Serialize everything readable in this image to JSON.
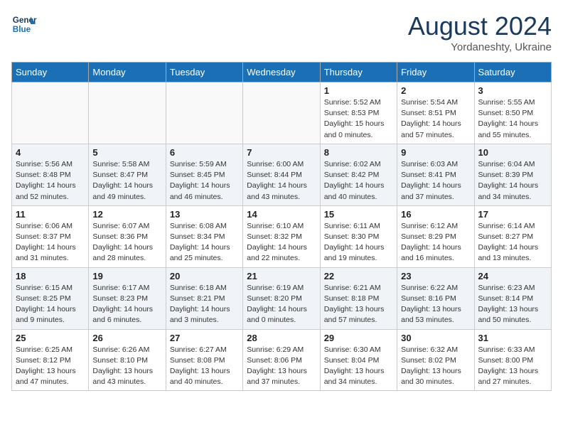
{
  "header": {
    "logo_line1": "General",
    "logo_line2": "Blue",
    "month_year": "August 2024",
    "location": "Yordaneshty, Ukraine"
  },
  "weekdays": [
    "Sunday",
    "Monday",
    "Tuesday",
    "Wednesday",
    "Thursday",
    "Friday",
    "Saturday"
  ],
  "weeks": [
    [
      {
        "day": "",
        "info": ""
      },
      {
        "day": "",
        "info": ""
      },
      {
        "day": "",
        "info": ""
      },
      {
        "day": "",
        "info": ""
      },
      {
        "day": "1",
        "info": "Sunrise: 5:52 AM\nSunset: 8:53 PM\nDaylight: 15 hours\nand 0 minutes."
      },
      {
        "day": "2",
        "info": "Sunrise: 5:54 AM\nSunset: 8:51 PM\nDaylight: 14 hours\nand 57 minutes."
      },
      {
        "day": "3",
        "info": "Sunrise: 5:55 AM\nSunset: 8:50 PM\nDaylight: 14 hours\nand 55 minutes."
      }
    ],
    [
      {
        "day": "4",
        "info": "Sunrise: 5:56 AM\nSunset: 8:48 PM\nDaylight: 14 hours\nand 52 minutes."
      },
      {
        "day": "5",
        "info": "Sunrise: 5:58 AM\nSunset: 8:47 PM\nDaylight: 14 hours\nand 49 minutes."
      },
      {
        "day": "6",
        "info": "Sunrise: 5:59 AM\nSunset: 8:45 PM\nDaylight: 14 hours\nand 46 minutes."
      },
      {
        "day": "7",
        "info": "Sunrise: 6:00 AM\nSunset: 8:44 PM\nDaylight: 14 hours\nand 43 minutes."
      },
      {
        "day": "8",
        "info": "Sunrise: 6:02 AM\nSunset: 8:42 PM\nDaylight: 14 hours\nand 40 minutes."
      },
      {
        "day": "9",
        "info": "Sunrise: 6:03 AM\nSunset: 8:41 PM\nDaylight: 14 hours\nand 37 minutes."
      },
      {
        "day": "10",
        "info": "Sunrise: 6:04 AM\nSunset: 8:39 PM\nDaylight: 14 hours\nand 34 minutes."
      }
    ],
    [
      {
        "day": "11",
        "info": "Sunrise: 6:06 AM\nSunset: 8:37 PM\nDaylight: 14 hours\nand 31 minutes."
      },
      {
        "day": "12",
        "info": "Sunrise: 6:07 AM\nSunset: 8:36 PM\nDaylight: 14 hours\nand 28 minutes."
      },
      {
        "day": "13",
        "info": "Sunrise: 6:08 AM\nSunset: 8:34 PM\nDaylight: 14 hours\nand 25 minutes."
      },
      {
        "day": "14",
        "info": "Sunrise: 6:10 AM\nSunset: 8:32 PM\nDaylight: 14 hours\nand 22 minutes."
      },
      {
        "day": "15",
        "info": "Sunrise: 6:11 AM\nSunset: 8:30 PM\nDaylight: 14 hours\nand 19 minutes."
      },
      {
        "day": "16",
        "info": "Sunrise: 6:12 AM\nSunset: 8:29 PM\nDaylight: 14 hours\nand 16 minutes."
      },
      {
        "day": "17",
        "info": "Sunrise: 6:14 AM\nSunset: 8:27 PM\nDaylight: 14 hours\nand 13 minutes."
      }
    ],
    [
      {
        "day": "18",
        "info": "Sunrise: 6:15 AM\nSunset: 8:25 PM\nDaylight: 14 hours\nand 9 minutes."
      },
      {
        "day": "19",
        "info": "Sunrise: 6:17 AM\nSunset: 8:23 PM\nDaylight: 14 hours\nand 6 minutes."
      },
      {
        "day": "20",
        "info": "Sunrise: 6:18 AM\nSunset: 8:21 PM\nDaylight: 14 hours\nand 3 minutes."
      },
      {
        "day": "21",
        "info": "Sunrise: 6:19 AM\nSunset: 8:20 PM\nDaylight: 14 hours\nand 0 minutes."
      },
      {
        "day": "22",
        "info": "Sunrise: 6:21 AM\nSunset: 8:18 PM\nDaylight: 13 hours\nand 57 minutes."
      },
      {
        "day": "23",
        "info": "Sunrise: 6:22 AM\nSunset: 8:16 PM\nDaylight: 13 hours\nand 53 minutes."
      },
      {
        "day": "24",
        "info": "Sunrise: 6:23 AM\nSunset: 8:14 PM\nDaylight: 13 hours\nand 50 minutes."
      }
    ],
    [
      {
        "day": "25",
        "info": "Sunrise: 6:25 AM\nSunset: 8:12 PM\nDaylight: 13 hours\nand 47 minutes."
      },
      {
        "day": "26",
        "info": "Sunrise: 6:26 AM\nSunset: 8:10 PM\nDaylight: 13 hours\nand 43 minutes."
      },
      {
        "day": "27",
        "info": "Sunrise: 6:27 AM\nSunset: 8:08 PM\nDaylight: 13 hours\nand 40 minutes."
      },
      {
        "day": "28",
        "info": "Sunrise: 6:29 AM\nSunset: 8:06 PM\nDaylight: 13 hours\nand 37 minutes."
      },
      {
        "day": "29",
        "info": "Sunrise: 6:30 AM\nSunset: 8:04 PM\nDaylight: 13 hours\nand 34 minutes."
      },
      {
        "day": "30",
        "info": "Sunrise: 6:32 AM\nSunset: 8:02 PM\nDaylight: 13 hours\nand 30 minutes."
      },
      {
        "day": "31",
        "info": "Sunrise: 6:33 AM\nSunset: 8:00 PM\nDaylight: 13 hours\nand 27 minutes."
      }
    ]
  ]
}
